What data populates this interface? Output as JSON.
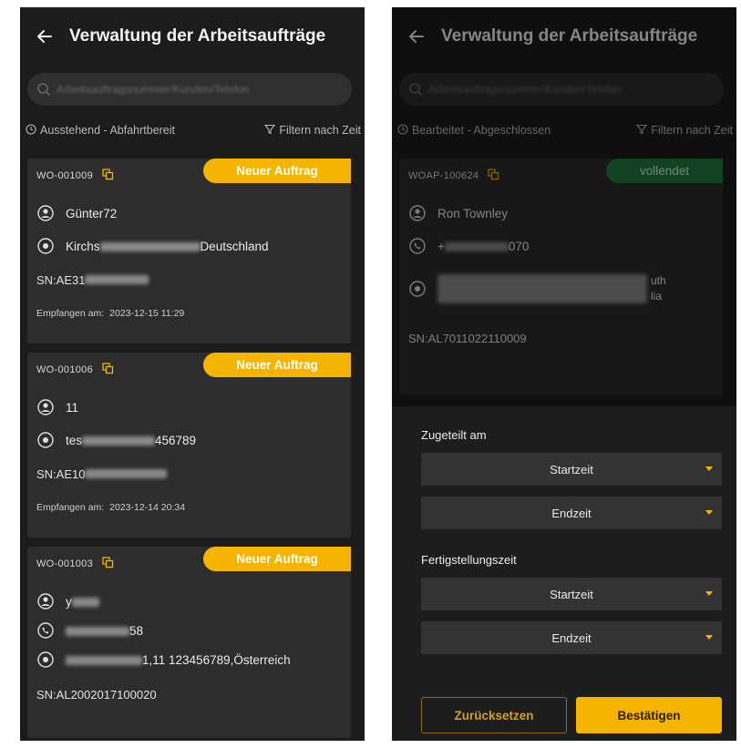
{
  "left": {
    "title": "Verwaltung der Arbeitsaufträge",
    "search_placeholder": "Arbeitsauftragsnummer/Kunden/Telefon",
    "filter_status": "Ausstehend - Abfahrtbereit",
    "filter_time": "Filtern nach Zeit",
    "orders": [
      {
        "id": "WO-001009",
        "badge": "Neuer Auftrag",
        "name": "Günter72",
        "address_start": "Kirchs",
        "address_end": "Deutschland",
        "sn": "SN:AE31",
        "received_label": "Empfangen am:",
        "received": "2023-12-15 11:29"
      },
      {
        "id": "WO-001006",
        "badge": "Neuer Auftrag",
        "name": "11",
        "address_start": "tes",
        "address_end": "456789",
        "sn": "SN:AE10",
        "received_label": "Empfangen am:",
        "received": "2023-12-14 20:34"
      },
      {
        "id": "WO-001003",
        "badge": "Neuer Auftrag",
        "name": "y",
        "phone_end": "58",
        "address_end": "1,11 123456789,Österreich",
        "sn": "SN:AL2002017100020"
      }
    ]
  },
  "right": {
    "title": "Verwaltung der Arbeitsaufträge",
    "search_placeholder": "Arbeitsauftragsnummer/Kunden/Telefon",
    "filter_status": "Bearbeitet - Abgeschlossen",
    "filter_time": "Filtern nach Zeit",
    "order": {
      "id": "WOAP-100624",
      "badge": "vollendet",
      "name": "Ron Townley",
      "phone_start": "+",
      "phone_end": "070",
      "address_line1": "uth",
      "address_line2": "lia",
      "sn": "SN:AL7011022110009"
    },
    "sheet": {
      "assigned_label": "Zugeteilt am",
      "completed_label": "Fertigstellungszeit",
      "start": "Startzeit",
      "end": "Endzeit",
      "reset": "Zurücksetzen",
      "confirm": "Bestätigen"
    }
  },
  "colors": {
    "accent": "#f5b400",
    "done": "#1f7a41",
    "background": "#1c1c1c",
    "card": "#2d2d2d"
  }
}
